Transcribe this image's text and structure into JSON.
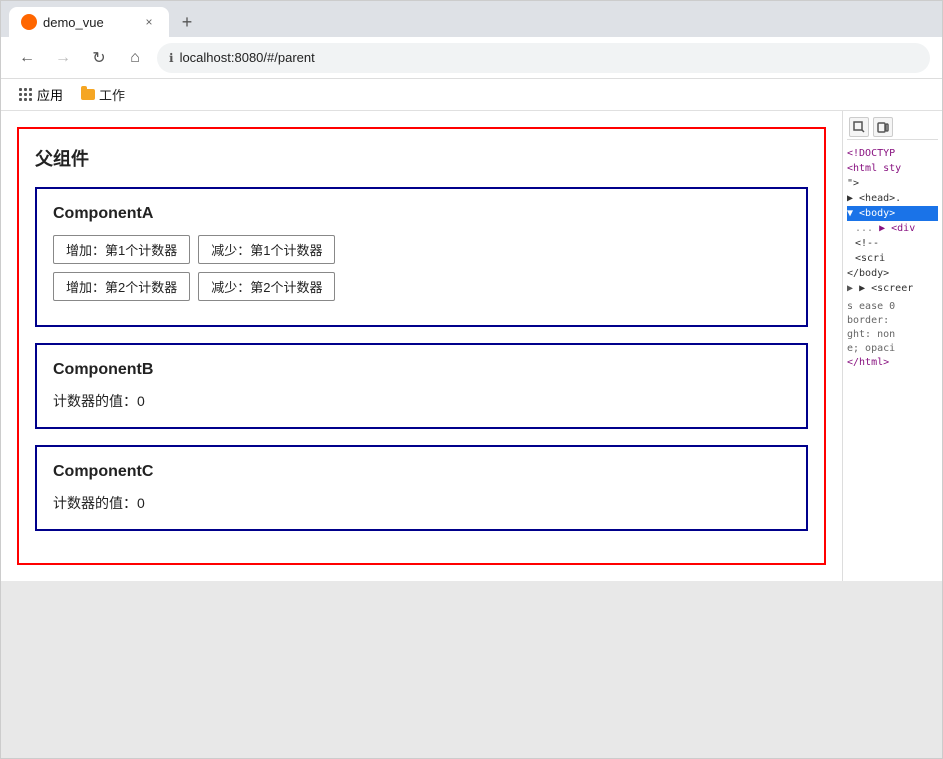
{
  "browser": {
    "tab_title": "demo_vue",
    "tab_favicon": "🔴",
    "close_label": "×",
    "new_tab_label": "+",
    "nav": {
      "back_label": "←",
      "forward_label": "→",
      "reload_label": "↻",
      "home_label": "⌂",
      "address": "localhost:8080/#/parent"
    },
    "bookmarks": {
      "apps_label": "应用",
      "folder_label": "工作"
    }
  },
  "devtools": {
    "toolbar": {
      "inspect_label": "⬚",
      "device_label": "▭"
    },
    "code": {
      "line1": "<!DOCTYP",
      "line2": "<html sty",
      "line3": "\">",
      "line4": "▶ <head>.",
      "line5": "▼ <body>",
      "line6": "  ▶ <div",
      "line7": "  <!--",
      "line8": "  <scri",
      "line9": "  </body>",
      "line10": "▶ <screer",
      "line11": "s ease 0",
      "line12": "border:",
      "line13": "ght: non",
      "line14": "e; opaci",
      "line15": "</html>"
    }
  },
  "app": {
    "parent": {
      "title": "父组件",
      "componentA": {
        "title": "ComponentA",
        "btn1_inc": "增加：第1个计数器",
        "btn1_dec": "减少：第1个计数器",
        "btn2_inc": "增加：第2个计数器",
        "btn2_dec": "减少：第2个计数器"
      },
      "componentB": {
        "title": "ComponentB",
        "counter_label": "计数器的值：",
        "counter_value": "0"
      },
      "componentC": {
        "title": "ComponentC",
        "counter_label": "计数器的值：",
        "counter_value": "0"
      }
    }
  }
}
